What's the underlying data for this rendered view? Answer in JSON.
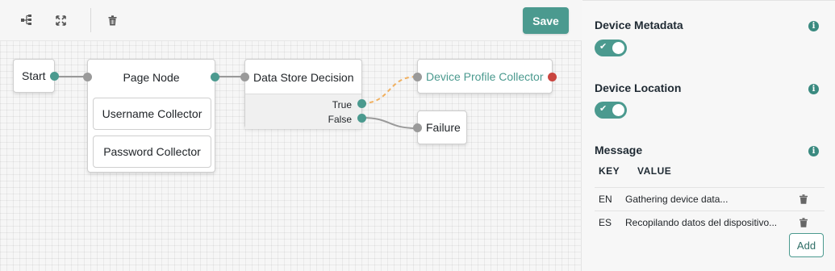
{
  "toolbar": {
    "icons": [
      "tree-layout-icon",
      "fullscreen-icon",
      "trash-icon"
    ],
    "save_label": "Save"
  },
  "nodes": {
    "start": "Start",
    "page_node": {
      "title": "Page Node",
      "children": [
        "Username Collector",
        "Password Collector"
      ]
    },
    "data_store_decision": {
      "title": "Data Store Decision",
      "outcomes": [
        "True",
        "False"
      ]
    },
    "device_profile_collector": "Device Profile Collector",
    "failure": "Failure"
  },
  "panel": {
    "device_metadata": {
      "label": "Device Metadata",
      "enabled": true
    },
    "device_location": {
      "label": "Device Location",
      "enabled": true
    },
    "message": {
      "label": "Message",
      "columns": [
        "KEY",
        "VALUE"
      ],
      "rows": [
        {
          "key": "EN",
          "value": "Gathering device data..."
        },
        {
          "key": "ES",
          "value": "Recopilando datos del dispositivo..."
        }
      ],
      "add_label": "Add"
    }
  },
  "colors": {
    "accent": "#4b9a8f",
    "error_port": "#c9453f",
    "dashed_wire": "#f0b060"
  }
}
